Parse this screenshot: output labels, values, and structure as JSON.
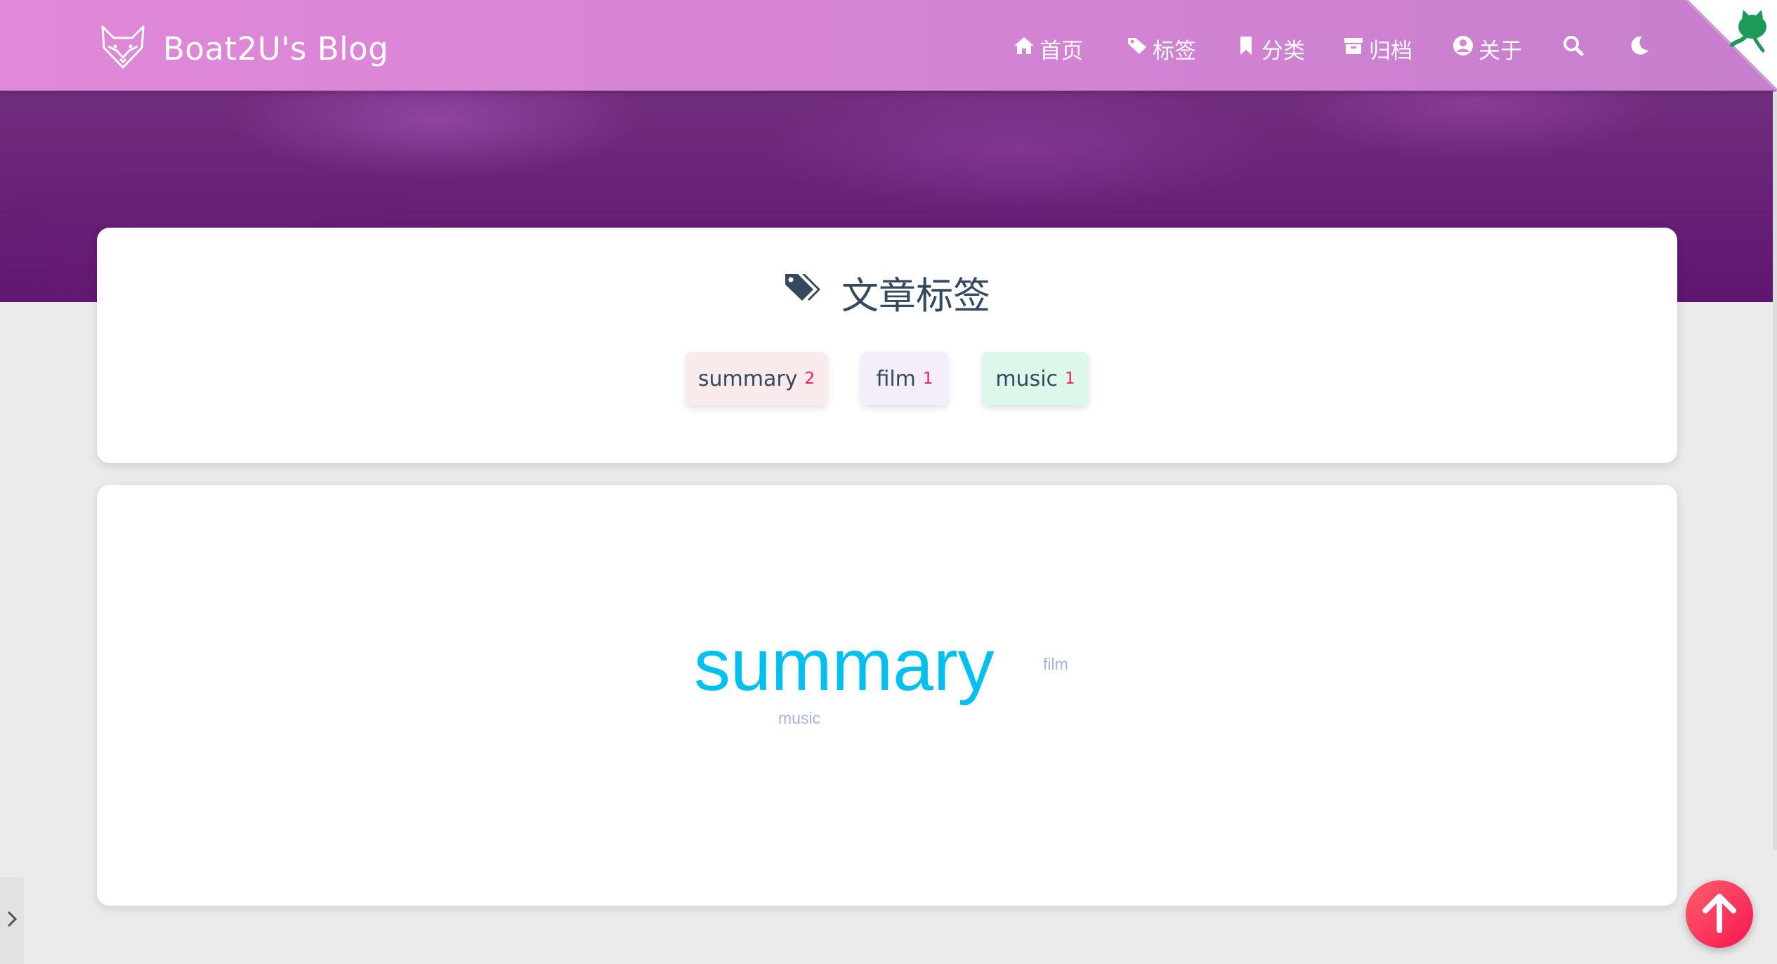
{
  "header": {
    "brand_title": "Boat2U's Blog",
    "nav": [
      {
        "label": "首页",
        "icon": "home-icon"
      },
      {
        "label": "标签",
        "icon": "tags-icon"
      },
      {
        "label": "分类",
        "icon": "bookmark-icon"
      },
      {
        "label": "归档",
        "icon": "archive-icon"
      },
      {
        "label": "关于",
        "icon": "user-circle-icon"
      }
    ],
    "search_icon": "search-icon",
    "theme_icon": "moon-icon"
  },
  "tags_card": {
    "title": "文章标签",
    "tags": [
      {
        "name": "summary",
        "count": "2",
        "bg": "#f9ebeb"
      },
      {
        "name": "film",
        "count": "1",
        "bg": "#f4eef8"
      },
      {
        "name": "music",
        "count": "1",
        "bg": "#def7eb"
      }
    ]
  },
  "tag_cloud": {
    "words": [
      {
        "text": "summary",
        "color": "#00c0f0"
      },
      {
        "text": "film",
        "color": "#a6b4df"
      },
      {
        "text": "music",
        "color": "#a6b4df"
      }
    ]
  },
  "colors": {
    "header_gradient_start": "#e088d9",
    "header_gradient_end": "#c67fcd",
    "count_color": "#e91e63",
    "to_top_button": "#f7164f",
    "corner_octocat": "#1d9a57"
  }
}
